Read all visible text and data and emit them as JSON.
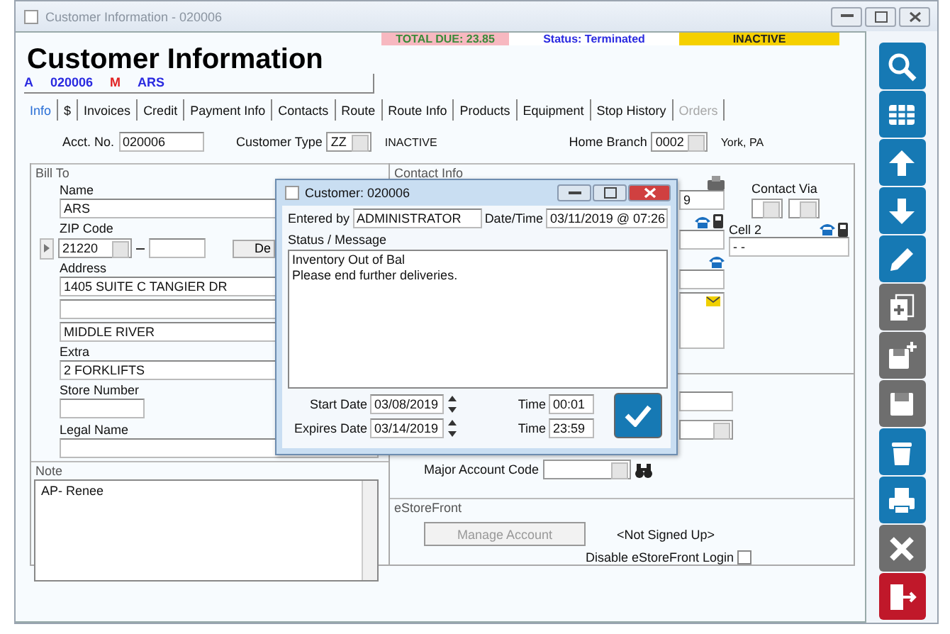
{
  "window": {
    "title": "Customer Information - 020006"
  },
  "status_strip": {
    "total_due": "TOTAL DUE:  23.85",
    "status": "Status: Terminated",
    "state": "INACTIVE"
  },
  "heading": "Customer Information",
  "summary": [
    {
      "text": "A",
      "color": "#2a2ae0"
    },
    {
      "text": "020006",
      "color": "#2a2ae0"
    },
    {
      "text": "M",
      "color": "#e02020"
    },
    {
      "text": "ARS",
      "color": "#2a2ae0"
    }
  ],
  "tabs": [
    {
      "label": "Info",
      "selected": true,
      "disabled": false
    },
    {
      "label": "$",
      "selected": false,
      "disabled": false
    },
    {
      "label": "Invoices",
      "selected": false,
      "disabled": false
    },
    {
      "label": "Credit",
      "selected": false,
      "disabled": false
    },
    {
      "label": "Payment Info",
      "selected": false,
      "disabled": false
    },
    {
      "label": "Contacts",
      "selected": false,
      "disabled": false
    },
    {
      "label": "Route",
      "selected": false,
      "disabled": false
    },
    {
      "label": "Route Info",
      "selected": false,
      "disabled": false
    },
    {
      "label": "Products",
      "selected": false,
      "disabled": false
    },
    {
      "label": "Equipment",
      "selected": false,
      "disabled": false
    },
    {
      "label": "Stop History",
      "selected": false,
      "disabled": false
    },
    {
      "label": "Orders",
      "selected": false,
      "disabled": true
    }
  ],
  "account": {
    "acct_no_label": "Acct. No.",
    "acct_no": "020006",
    "customer_type_label": "Customer Type",
    "customer_type": "ZZ",
    "customer_type_status": "INACTIVE",
    "home_branch_label": "Home Branch",
    "home_branch": "0002",
    "branch_location": "York, PA"
  },
  "bill_to": {
    "title": "Bill To",
    "name_label": "Name",
    "name": "ARS",
    "zip_label": "ZIP Code",
    "zip": "21220",
    "partial_button": "De",
    "address_label": "Address",
    "address": "1405 SUITE C TANGIER DR",
    "city": "MIDDLE RIVER",
    "extra_label": "Extra",
    "extra": "2 FORKLIFTS",
    "store_number_label": "Store Number",
    "legal_name_label": "Legal Name"
  },
  "note": {
    "title": "Note",
    "text": "AP- Renee"
  },
  "contact_info": {
    "title": "Contact Info",
    "partial_value": "9",
    "contact_via_label": "Contact Via",
    "cell2_label": "Cell 2",
    "cell2": "-  -"
  },
  "major_account_code_label": "Major Account Code",
  "estorefront": {
    "title": "eStoreFront",
    "manage_button": "Manage Account",
    "manage_disabled": true,
    "signup_status": "<Not Signed Up>",
    "disable_login_label": "Disable eStoreFront Login",
    "disable_login_checked": false
  },
  "dialog": {
    "title": "Customer: 020006",
    "entered_by_label": "Entered by",
    "entered_by": "ADMINISTRATOR",
    "datetime_label": "Date/Time",
    "datetime": "03/11/2019 @ 07:26",
    "message_label": "Status / Message",
    "message": "Inventory Out of Bal\nPlease end further deliveries.",
    "start_date_label": "Start Date",
    "start_date": "03/08/2019",
    "start_time_label": "Time",
    "start_time": "00:01",
    "expires_date_label": "Expires Date",
    "expires_date": "03/14/2019",
    "expires_time_label": "Time",
    "expires_time": "23:59"
  },
  "toolbar": [
    {
      "kind": "search",
      "disabled": false
    },
    {
      "kind": "grid",
      "disabled": false
    },
    {
      "kind": "up",
      "disabled": false
    },
    {
      "kind": "down",
      "disabled": false
    },
    {
      "kind": "edit",
      "disabled": false
    },
    {
      "kind": "copy",
      "disabled": true
    },
    {
      "kind": "add",
      "disabled": true
    },
    {
      "kind": "save",
      "disabled": true
    },
    {
      "kind": "delete",
      "disabled": false
    },
    {
      "kind": "print",
      "disabled": false
    },
    {
      "kind": "cancel",
      "disabled": true
    },
    {
      "kind": "exit",
      "disabled": false
    }
  ]
}
